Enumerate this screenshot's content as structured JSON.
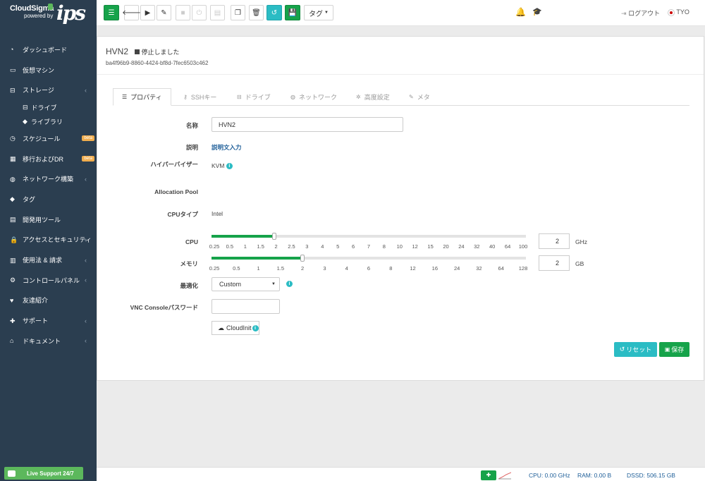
{
  "brand": {
    "name": "CloudSigma",
    "powered": "powered by",
    "partner": "ips"
  },
  "sidebar": {
    "items": [
      {
        "label": "ダッシュボード",
        "icon": "dashboard-icon"
      },
      {
        "label": "仮想マシン",
        "icon": "monitor-icon"
      },
      {
        "label": "ストレージ",
        "icon": "storage-icon",
        "chevron": "‹"
      },
      {
        "label": "ドライブ",
        "icon": "drive-icon",
        "sub": true
      },
      {
        "label": "ライブラリ",
        "icon": "tags-icon",
        "sub": true
      },
      {
        "label": "スケジュール",
        "icon": "clock-icon",
        "badge": "beta"
      },
      {
        "label": "移行およびDR",
        "icon": "migrate-icon",
        "badge": "beta"
      },
      {
        "label": "ネットワーク構築",
        "icon": "network-icon",
        "chevron": "‹"
      },
      {
        "label": "タグ",
        "icon": "tag-icon"
      },
      {
        "label": "開発用ツール",
        "icon": "devtools-icon"
      },
      {
        "label": "アクセスとセキュリティ",
        "icon": "lock-icon",
        "chevron": "‹"
      },
      {
        "label": "使用法 & 請求",
        "icon": "billing-icon",
        "chevron": "‹"
      },
      {
        "label": "コントロールパネル",
        "icon": "settings-icon",
        "chevron": "‹"
      },
      {
        "label": "友達紹介",
        "icon": "heart-icon"
      },
      {
        "label": "サポート",
        "icon": "support-icon",
        "chevron": "‹"
      },
      {
        "label": "ドキュメント",
        "icon": "docs-icon",
        "chevron": "‹"
      }
    ],
    "live_support": "Live Support 24/7"
  },
  "toolbar": {
    "tag_label": "タグ",
    "logout": "ログアウト",
    "region": "TYO"
  },
  "vm": {
    "name": "HVN2",
    "status": "停止しました",
    "uuid": "ba4f96b9-8860-4424-bf8d-7fec6503c462"
  },
  "tabs": [
    {
      "label": "プロパティ",
      "icon": "list-icon",
      "active": true
    },
    {
      "label": "SSHキー",
      "icon": "key-icon"
    },
    {
      "label": "ドライブ",
      "icon": "drive-icon"
    },
    {
      "label": "ネットワーク",
      "icon": "globe-icon"
    },
    {
      "label": "高度設定",
      "icon": "gear-icon"
    },
    {
      "label": "メタ",
      "icon": "pencil-icon"
    }
  ],
  "form": {
    "name_label": "名称",
    "name_value": "HVN2",
    "desc_label": "説明",
    "desc_link": "説明文入力",
    "hypervisor_label": "ハイパーバイザー",
    "hypervisor_value": "KVM",
    "pool_label": "Allocation Pool",
    "cputype_label": "CPUタイプ",
    "cputype_value": "Intel",
    "cpu_label": "CPU",
    "cpu_value": "2",
    "cpu_unit": "GHz",
    "cpu_ticks": [
      "0.25",
      "0.5",
      "1",
      "1.5",
      "2",
      "2.5",
      "3",
      "4",
      "5",
      "6",
      "7",
      "8",
      "10",
      "12",
      "15",
      "20",
      "24",
      "32",
      "40",
      "64",
      "100"
    ],
    "cpu_level": 0.2,
    "mem_label": "メモリ",
    "mem_value": "2",
    "mem_unit": "GB",
    "mem_ticks": [
      "0.25",
      "0.5",
      "1",
      "1.5",
      "2",
      "3",
      "4",
      "6",
      "8",
      "12",
      "16",
      "24",
      "32",
      "64",
      "128"
    ],
    "mem_level": 0.29,
    "opt_label": "最適化",
    "opt_value": "Custom",
    "vnc_label": "VNC Consoleパスワード",
    "vnc_value": "",
    "cloudinit_label": "CloudInit",
    "reset_label": "リセット",
    "save_label": "保存"
  },
  "footer": {
    "cpu": "CPU: 0.00 GHz",
    "ram": "RAM: 0.00 B",
    "dssd": "DSSD: 506.15 GB"
  },
  "colors": {
    "sidebar": "#2b3e50",
    "green": "#16a34a",
    "teal": "#2bbcc4",
    "badge": "#f0ad4e"
  }
}
